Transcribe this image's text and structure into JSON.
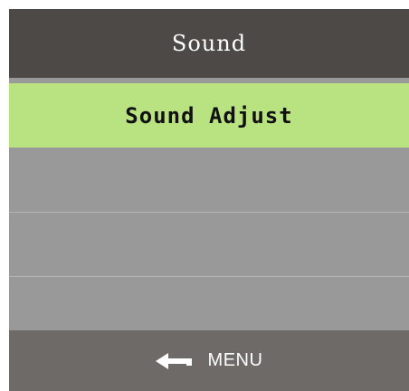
{
  "header": {
    "title": "Sound"
  },
  "menu": {
    "items": [
      {
        "label": "Sound Adjust",
        "selected": true
      },
      {
        "label": "",
        "selected": false
      },
      {
        "label": "",
        "selected": false
      },
      {
        "label": "",
        "selected": false
      }
    ]
  },
  "footer": {
    "back_icon": "left-arrow-return-icon",
    "label": "MENU"
  },
  "colors": {
    "header_bg": "#4d4946",
    "selected_bg": "#b9e281",
    "item_bg": "#999999",
    "footer_bg": "#6d6a68"
  }
}
